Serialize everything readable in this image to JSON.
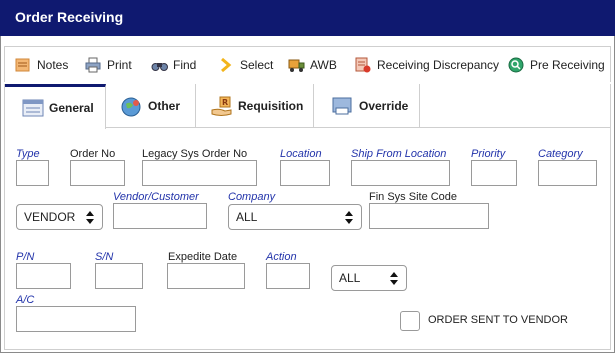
{
  "window": {
    "title": "Order Receiving"
  },
  "toolbar": {
    "items": [
      {
        "label": "Notes",
        "icon": "notes-icon"
      },
      {
        "label": "Print",
        "icon": "print-icon"
      },
      {
        "label": "Find",
        "icon": "binoculars-icon"
      },
      {
        "label": "Select",
        "icon": "select-chevron-icon"
      },
      {
        "label": "AWB",
        "icon": "truck-icon"
      },
      {
        "label": "Receiving Discrepancy",
        "icon": "discrepancy-icon"
      },
      {
        "label": "Pre Receiving",
        "icon": "pre-receiving-icon"
      }
    ]
  },
  "tabs": [
    {
      "label": "General",
      "active": true,
      "icon": "general-tab-icon"
    },
    {
      "label": "Other",
      "active": false,
      "icon": "globe-icon"
    },
    {
      "label": "Requisition",
      "active": false,
      "icon": "requisition-hand-icon"
    },
    {
      "label": "Override",
      "active": false,
      "icon": "override-icon"
    }
  ],
  "form": {
    "type": {
      "label": "Type",
      "value": ""
    },
    "order_no": {
      "label": "Order No",
      "value": ""
    },
    "legacy_sys_order_no": {
      "label": "Legacy Sys Order No",
      "value": ""
    },
    "location": {
      "label": "Location",
      "value": ""
    },
    "ship_from_location": {
      "label": "Ship From Location",
      "value": ""
    },
    "priority": {
      "label": "Priority",
      "value": ""
    },
    "category": {
      "label": "Category",
      "value": ""
    },
    "vendor_select": {
      "value": "VENDOR"
    },
    "vendor_customer": {
      "label": "Vendor/Customer",
      "value": ""
    },
    "company": {
      "label": "Company",
      "value": "ALL"
    },
    "fin_sys_site_code": {
      "label": "Fin Sys Site Code",
      "value": ""
    },
    "pn": {
      "label": "P/N",
      "value": ""
    },
    "sn": {
      "label": "S/N",
      "value": ""
    },
    "expedite_date": {
      "label": "Expedite Date",
      "value": ""
    },
    "action": {
      "label": "Action",
      "value": ""
    },
    "action_select": {
      "value": "ALL"
    },
    "ac": {
      "label": "A/C",
      "value": ""
    },
    "order_sent_to_vendor": {
      "label": "ORDER SENT TO VENDOR",
      "checked": false
    }
  },
  "colors": {
    "titlebar": "#0f1970",
    "link_label": "#2233aa"
  }
}
